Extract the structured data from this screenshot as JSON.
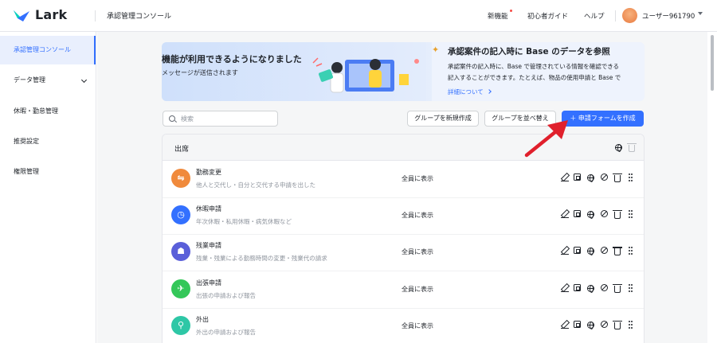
{
  "topbar": {
    "logo_text": "Lark",
    "console_title": "承認管理コンソール",
    "links": [
      "新機能",
      "初心者ガイド",
      "ヘルプ"
    ],
    "username": "ユーザー961790"
  },
  "sidebar": {
    "items": [
      {
        "label": "承認管理コンソール",
        "active": true
      },
      {
        "label": "データ管理",
        "has_chevron": true
      },
      {
        "label": "休暇・勤怠管理"
      },
      {
        "label": "推奨設定"
      },
      {
        "label": "権限管理"
      }
    ]
  },
  "banner": {
    "left_title": "機能が利用できるようになりました",
    "left_subtitle": "メッセージが送信されます",
    "right_title": "承認案件の記入時に Base のデータを参照",
    "right_line1": "承認案件の記入時に、Base で管理されている情報を確認できる",
    "right_line2": "記入することができます。たとえば、物品の使用申請と Base で",
    "right_link": "詳細について"
  },
  "toolbar": {
    "search_placeholder": "検索",
    "new_group": "グループを新規作成",
    "sort_groups": "グループを並べ替え",
    "create_form": "＋ 申請フォームを作成"
  },
  "group": {
    "title": "出席",
    "rows": [
      {
        "name": "勤務変更",
        "desc": "他人と交代し・自分と交代する申請を出した",
        "visibility": "全員に表示",
        "icon_color": "#f08a3c",
        "icon_glyph": "⇋",
        "icon": "swap-icon"
      },
      {
        "name": "休暇申請",
        "desc": "年次休暇・私用休暇・病気休暇など",
        "visibility": "全員に表示",
        "icon_color": "#3370ff",
        "icon_glyph": "◷",
        "icon": "clock-icon"
      },
      {
        "name": "残業申請",
        "desc": "残業・残業による勤務時間の変更・残業代の請求",
        "visibility": "全員に表示",
        "icon_color": "#5a5fd9",
        "icon_glyph": "☗",
        "icon": "lamp-icon"
      },
      {
        "name": "出張申請",
        "desc": "出張の申請および報告",
        "visibility": "全員に表示",
        "icon_color": "#34c759",
        "icon_glyph": "✈",
        "icon": "plane-icon"
      },
      {
        "name": "外出",
        "desc": "外出の申請および報告",
        "visibility": "全員に表示",
        "icon_color": "#2ec7a6",
        "icon_glyph": "⚲",
        "icon": "location-icon"
      }
    ]
  },
  "colors": {
    "accent": "#3370ff",
    "annotation_arrow": "#e0202c"
  }
}
